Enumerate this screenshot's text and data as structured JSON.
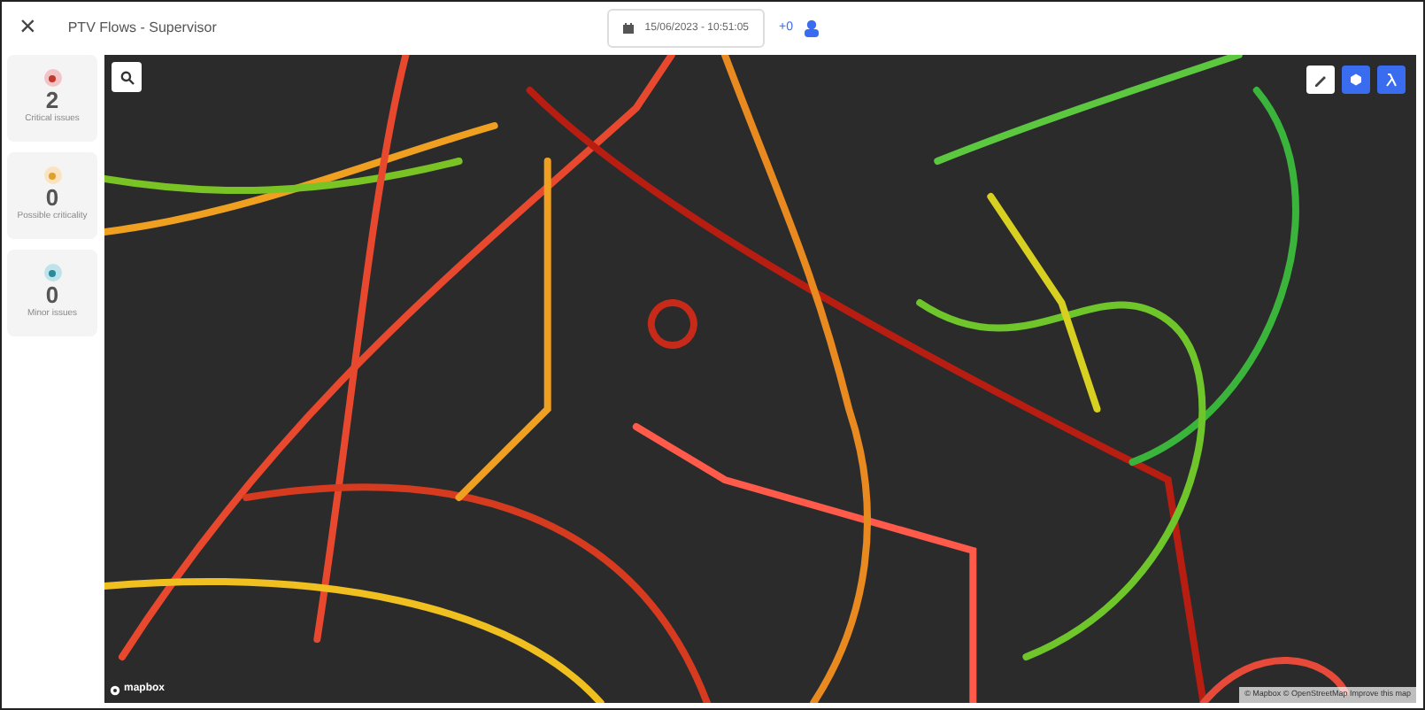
{
  "header": {
    "close": "×",
    "title": "PTV Flows - Supervisor",
    "datetime": "15/06/2023 - 10:51:05",
    "counter": "+0"
  },
  "sidebar": {
    "cards": [
      {
        "kind": "critical",
        "count": "2",
        "label": "Critical issues",
        "color": "#f2c4c8"
      },
      {
        "kind": "possible",
        "count": "0",
        "label": "Possible criticality",
        "color": "#fbe3bf"
      },
      {
        "kind": "minor",
        "count": "0",
        "label": "Minor issues",
        "color": "#bfe3ea"
      }
    ]
  },
  "map": {
    "toolbar": [
      {
        "kind": "edit"
      },
      {
        "kind": "shape"
      },
      {
        "kind": "lambda"
      }
    ],
    "logo": "mapbox",
    "attribution": "© Mapbox © OpenStreetMap Improve this map"
  }
}
